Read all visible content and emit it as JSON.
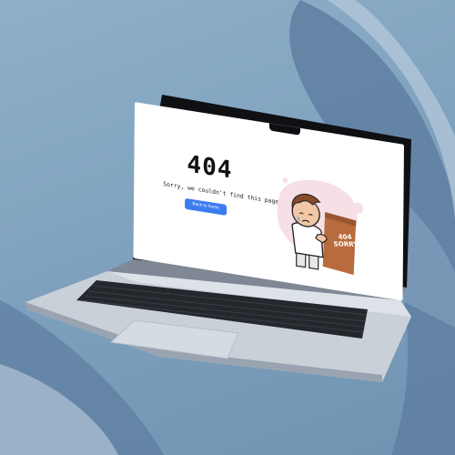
{
  "screen": {
    "error_code": "404",
    "message": "Sorry, we couldn't find this page.",
    "button_label": "Back to home",
    "sign_code": "404",
    "sign_text": "SORRY"
  },
  "colors": {
    "background": "#8fb0c9",
    "button": "#3b7cf0",
    "laptop_body": "#c7cdd5",
    "keyboard": "#22252a"
  },
  "icons": [
    "sad-boy-illustration-icon"
  ]
}
